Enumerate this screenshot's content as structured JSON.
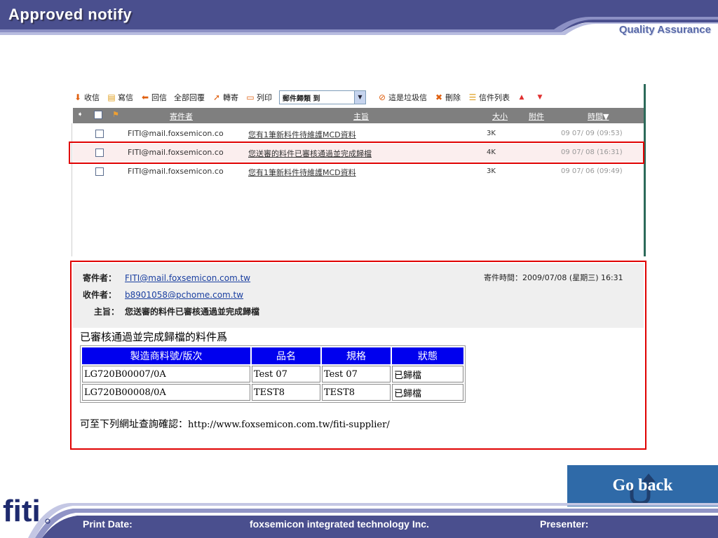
{
  "slide": {
    "title": "Approved notify",
    "department": "Quality Assurance"
  },
  "toolbar": {
    "inbox": "收信",
    "compose": "寫信",
    "reply": "回信",
    "reply_all": "全部回覆",
    "forward": "轉寄",
    "print": "列印",
    "move_select": "郵件歸類 到",
    "spam": "這是垃圾信",
    "delete": "刪除",
    "list": "信件列表"
  },
  "list_header": {
    "sender": "寄件者",
    "subject": "主旨",
    "size": "大小",
    "attachment": "附件",
    "time": "時間▼"
  },
  "messages": [
    {
      "from": "FITI@mail.foxsemicon.co",
      "subject": "您有1筆新料件待維護MCD資料",
      "size": "3K",
      "time": "09 07/ 09 (09:53)"
    },
    {
      "from": "FITI@mail.foxsemicon.co",
      "subject": "您送審的料件已審核通過並完成歸檔",
      "size": "4K",
      "time": "09 07/ 08 (16:31)"
    },
    {
      "from": "FITI@mail.foxsemicon.co",
      "subject": "您有1筆新料件待維護MCD資料",
      "size": "3K",
      "time": "09 07/ 06 (09:49)"
    }
  ],
  "preview": {
    "from_label": "寄件者：",
    "from": "FITI@mail.foxsemicon.com.tw",
    "to_label": "收件者：",
    "to": "b8901058@pchome.com.tw",
    "subject_label": "主旨：",
    "subject": "您送審的料件已審核通過並完成歸檔",
    "sent_time": "寄件時間：2009/07/08 (星期三) 16:31",
    "intro": "已審核通過並完成歸檔的料件爲",
    "table": {
      "headers": [
        "製造商料號/版次",
        "品名",
        "規格",
        "狀態"
      ],
      "rows": [
        [
          "LG720B00007/0A",
          "Test 07",
          "Test 07",
          "已歸檔"
        ],
        [
          "LG720B00008/0A",
          "TEST8",
          "TEST8",
          "已歸檔"
        ]
      ]
    },
    "outro": "可至下列網址查詢確認：",
    "url": "http://www.foxsemicon.com.tw/fiti-supplier/"
  },
  "go_back": "Go back",
  "footer": {
    "print_date": "Print Date:",
    "company": "foxsemicon integrated technology Inc.",
    "presenter": "Presenter:",
    "logo_text": "fiti"
  },
  "colors": {
    "header_navy": "#4a4f8e",
    "accent_purple": "#7b80b8",
    "highlight_red": "#e00000",
    "table_header_blue": "#0000ee",
    "go_back_blue": "#2f6aa8"
  }
}
